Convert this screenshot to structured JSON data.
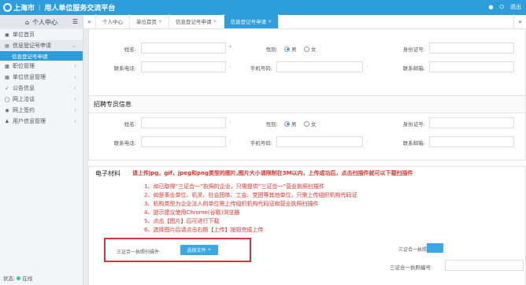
{
  "header": {
    "logo_text": "上海市",
    "separator": "|",
    "title": "用人单位服务交流平台",
    "user_label": "",
    "logout_label": "退出"
  },
  "sidebar": {
    "title": "个人中心",
    "items": [
      {
        "label": "单位首页",
        "icon": "home-icon"
      },
      {
        "label": "信息登记号申请",
        "icon": "doc-icon",
        "expanded": true
      },
      {
        "label": "职位管理",
        "icon": "briefcase-icon"
      },
      {
        "label": "单位信息管理",
        "icon": "building-icon"
      },
      {
        "label": "公告信息",
        "icon": "check-icon"
      },
      {
        "label": "网上洽谈",
        "icon": "globe-icon"
      },
      {
        "label": "网上签约",
        "icon": "eye-icon"
      },
      {
        "label": "用户信息管理",
        "icon": "user-icon"
      }
    ],
    "sub_item": "信息登记号申请",
    "status_label": "状态:",
    "status_value": "在线"
  },
  "tabs": [
    {
      "label": "个人中心",
      "closable": false,
      "active": false
    },
    {
      "label": "单位首页",
      "closable": true,
      "active": false
    },
    {
      "label": "信息登记号申请",
      "closable": true,
      "active": false
    },
    {
      "label": "信息登记号申请",
      "closable": true,
      "active": true
    }
  ],
  "section1": {
    "row1": {
      "name_label": "姓名:",
      "gender_label": "性别:",
      "male": "男",
      "female": "女",
      "id_label": "身份证号:"
    },
    "row2": {
      "phone_label": "联系电话:",
      "mobile_label": "手机号码:",
      "email_label": "联系邮箱:"
    }
  },
  "section2": {
    "title": "招聘专员信息",
    "row1": {
      "name_label": "姓名:",
      "gender_label": "性别:",
      "male": "男",
      "female": "女",
      "id_label": "身份证号:"
    },
    "row2": {
      "phone_label": "联系电话:",
      "mobile_label": "手机号码:",
      "email_label": "联系邮箱:"
    }
  },
  "materials": {
    "title": "电子材料",
    "note": "请上传jpg，gif，jpeg和png类型的图片,图片大小请限制在3M以内，上传成功后，点击扫描件就可以下载扫描件",
    "instructions": [
      "1、如已取得“三证合一”执照的企业，只需提供“三证合一”营业执照扫描件",
      "2、如是事业单位、机关、社会团体、工会、党团等其他单位，只需上传组织机构代码证",
      "3、机构类型为企业法人的单位需上传组织机构代码证和营业执照扫描件",
      "4、提示建议使用Chrome(谷歌)浏览器",
      "5、点击【图片】后可进行下载",
      "6、选择图片后请点击右侧【上传】按钮完成上传"
    ],
    "upload_label": "三证合一执照扫描件:",
    "upload_button": "选择文件",
    "right_upload_label": "三证合一执照扫描件:",
    "license_label": "三证合一执照编号:"
  }
}
